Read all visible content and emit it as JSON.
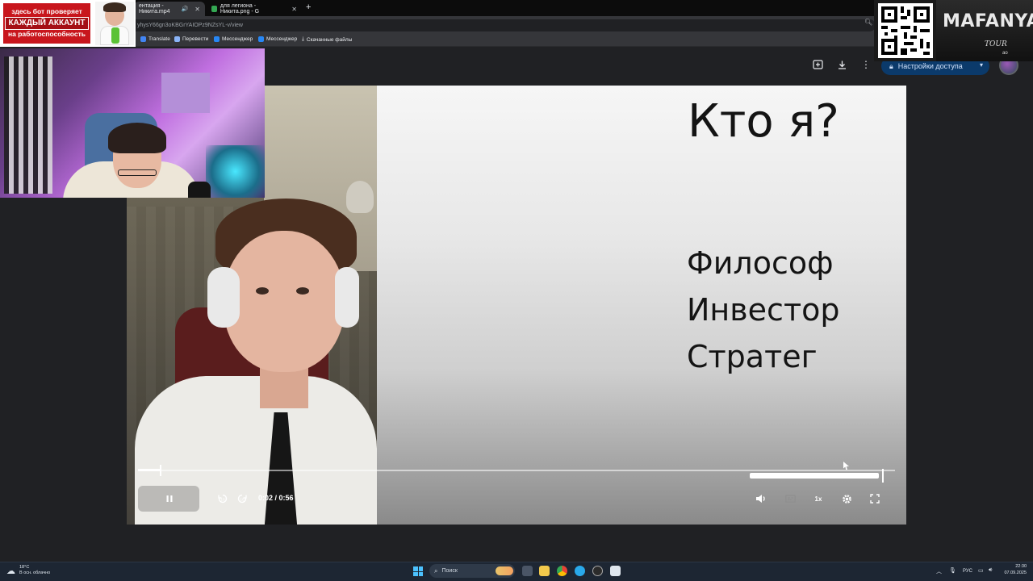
{
  "browser": {
    "tabs": [
      {
        "title": "ентация - Никита.mp4",
        "active": true
      },
      {
        "title": "для легиона - Никита.png - G",
        "active": false
      }
    ],
    "new_tab": "+",
    "address": "yhysY66gn3oKBGrYAIOPz9NZsYL-v/view",
    "bookmarks": [
      "Translate",
      "Перевести",
      "Мессенджер",
      "Мессенджер",
      "Скачанные файлы"
    ]
  },
  "viewer": {
    "share_label": "Настройки доступа",
    "icons": [
      "add-comment-icon",
      "download-icon",
      "more-vert-icon"
    ]
  },
  "slide": {
    "title": "Кто я?",
    "lines": [
      "Философ",
      "Инвестор",
      "Стратег"
    ]
  },
  "player": {
    "time": "0:02 / 0:56",
    "current_seconds": 2,
    "duration_seconds": 56,
    "speed": "1x",
    "volume_fraction": 1.0,
    "icons": [
      "pause-icon",
      "rewind-10-icon",
      "forward-10-icon",
      "volume-icon",
      "captions-icon",
      "settings-icon",
      "fullscreen-icon"
    ]
  },
  "overlay": {
    "promo_lines": [
      "здесь бот проверяет",
      "КАЖДЫЙ АККАУНТ",
      "на работоспособность"
    ],
    "brand": "MAFANYA",
    "tour": "TOUR",
    "tour_sub": "ао"
  },
  "taskbar": {
    "weather_temp": "18°C",
    "weather_desc": "В осн. облачно",
    "search_placeholder": "Поиск",
    "lang": "РУС",
    "time": "22:30",
    "date": "07.09.2025"
  },
  "colors": {
    "share_bg": "#0b3a6b",
    "promo_red": "#c8161d",
    "windows_accent": "#4cc2ff"
  }
}
